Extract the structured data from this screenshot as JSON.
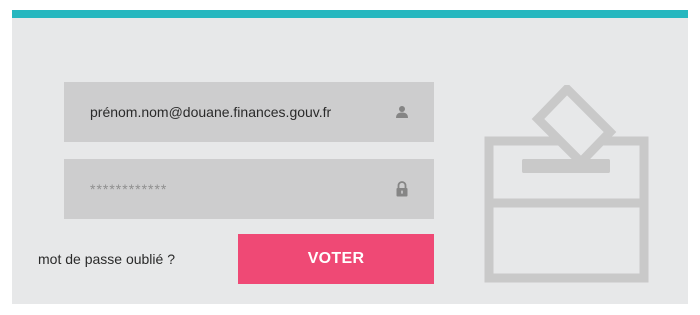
{
  "colors": {
    "accent_bar": "#26b7bf",
    "panel_bg": "#e7e8e9",
    "field_bg": "#cdcdce",
    "button_bg": "#ef4975",
    "icon": "#858585",
    "illustration": "#c9c9c9"
  },
  "login": {
    "email_value": "prénom.nom@douane.finances.gouv.fr",
    "email_icon": "user-icon",
    "password_placeholder": "************",
    "password_icon": "lock-icon",
    "forgot_password": "mot de passe oublié ?",
    "submit": "VOTER"
  },
  "illustration": {
    "icon": "ballot-box-icon"
  }
}
